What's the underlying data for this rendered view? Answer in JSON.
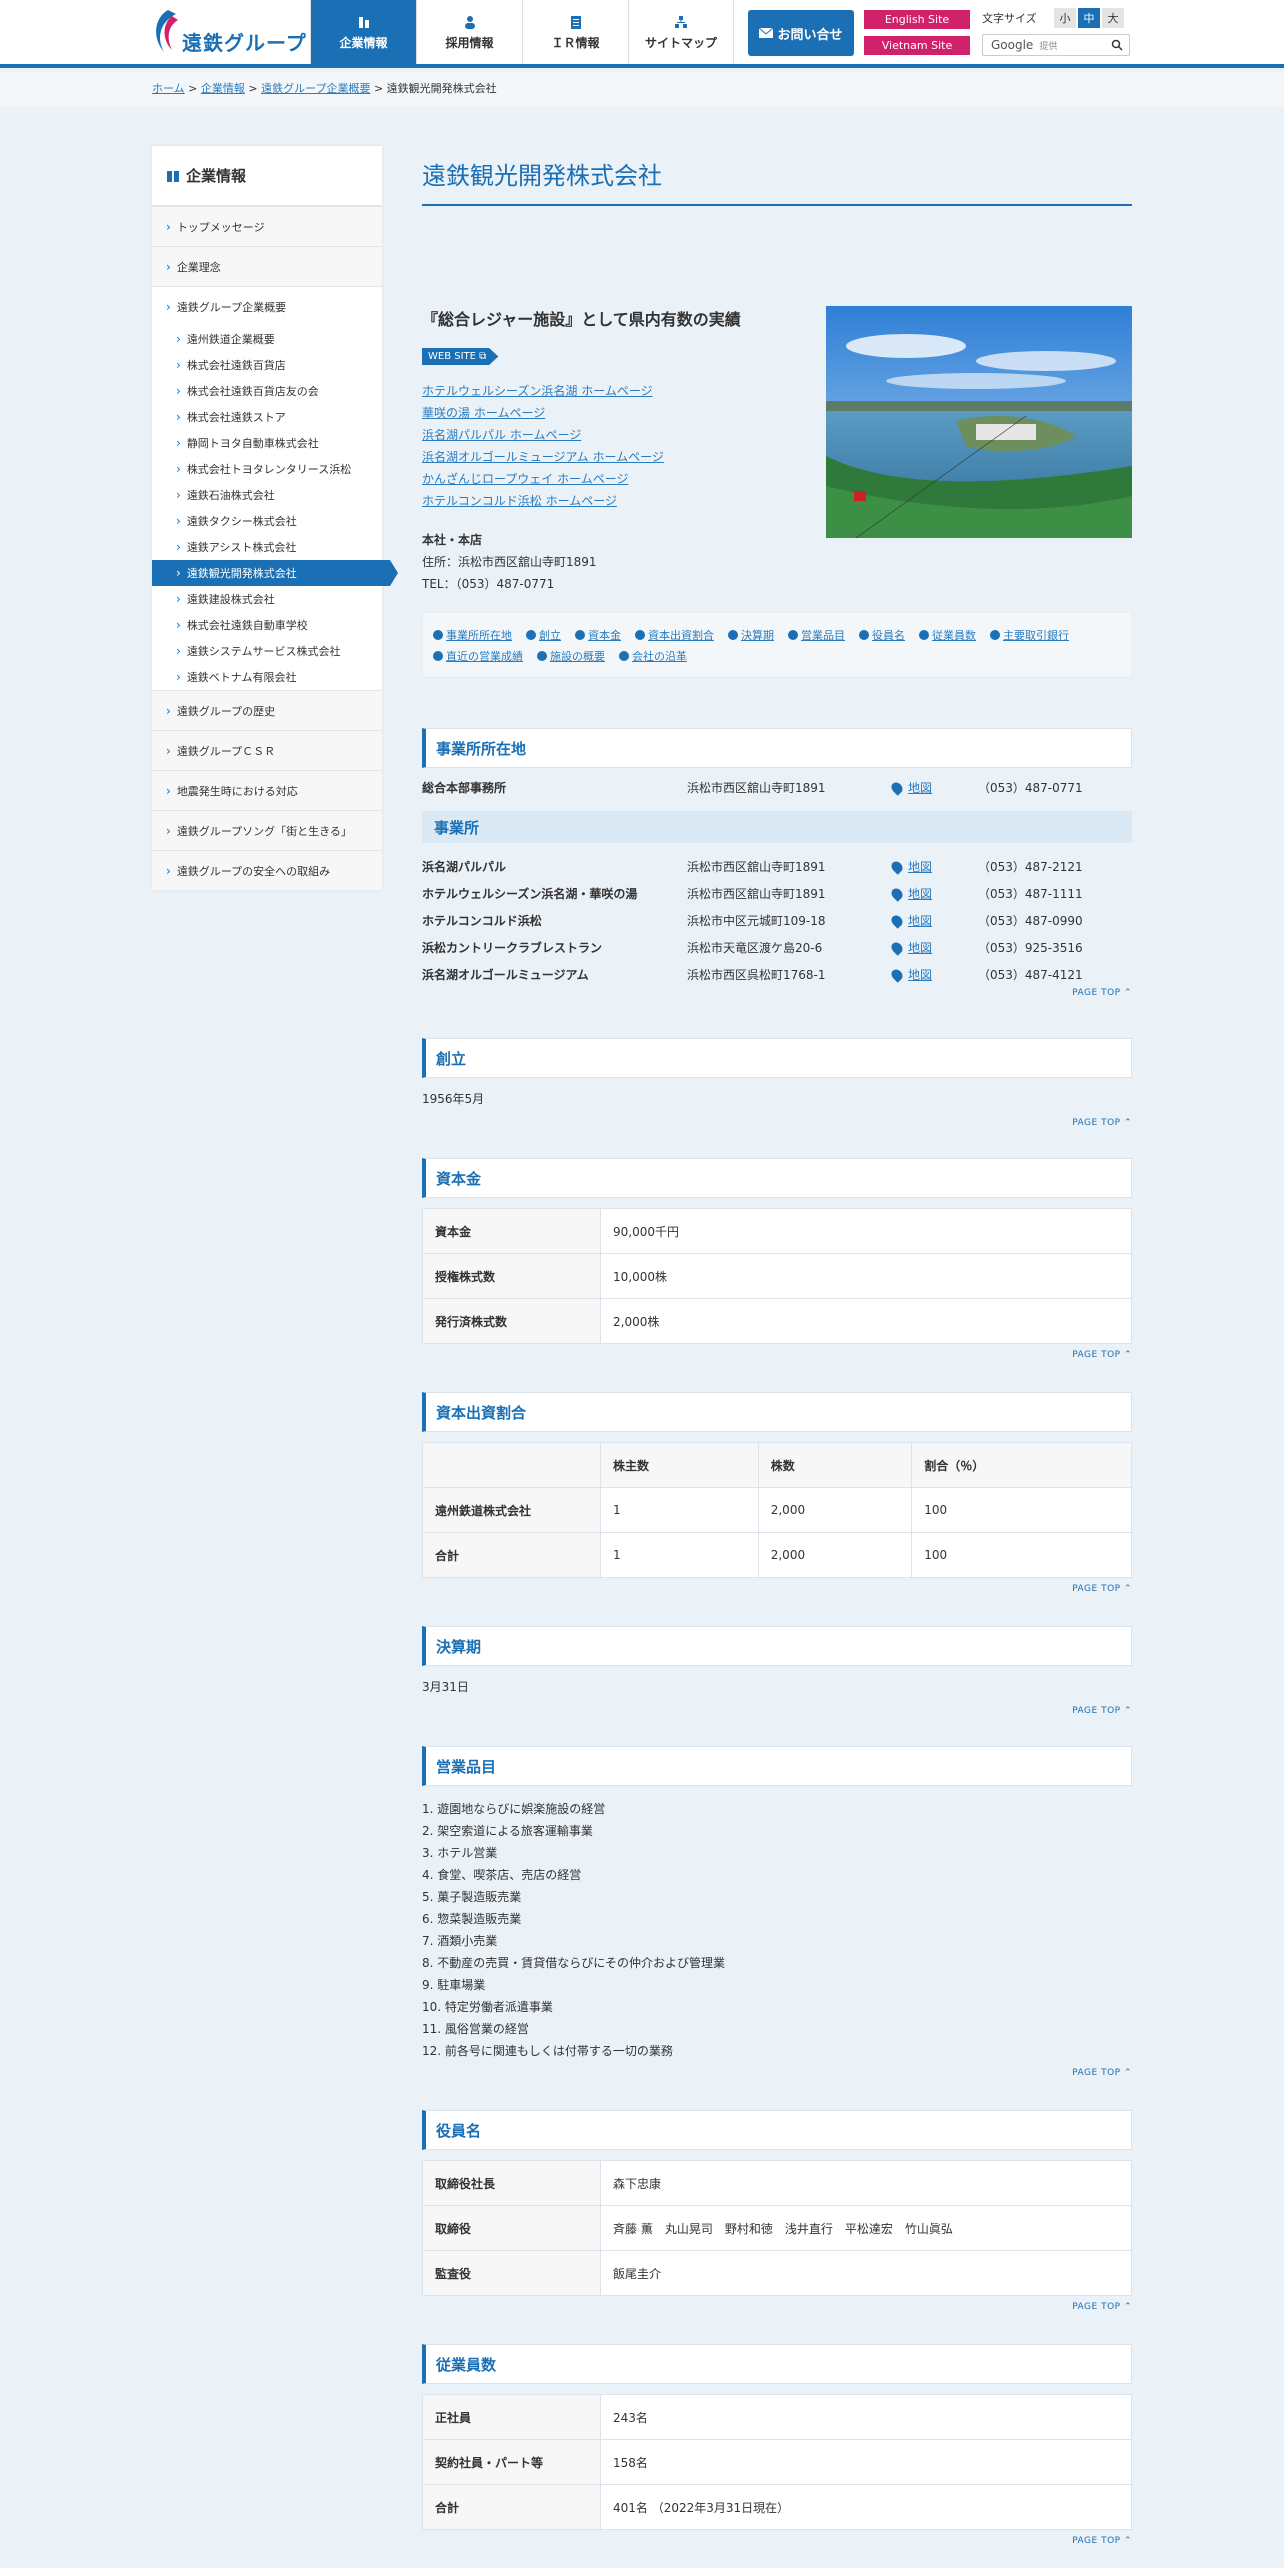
{
  "header": {
    "logo_text": "遠鉄グループ",
    "nav": [
      {
        "label": "企業情報",
        "icon": "building-icon"
      },
      {
        "label": "採用情報",
        "icon": "person-icon"
      },
      {
        "label": "ＩＲ情報",
        "icon": "document-icon"
      },
      {
        "label": "サイトマップ",
        "icon": "sitemap-icon"
      }
    ],
    "contact": "お問い合せ",
    "english": "English Site",
    "vietnam": "Vietnam Site",
    "fontsize_label": "文字サイズ",
    "fs_small": "小",
    "fs_mid": "中",
    "fs_large": "大",
    "search_google": "Google",
    "search_placeholder": "提供"
  },
  "breadcrumb": {
    "home": "ホーム",
    "corp": "企業情報",
    "group": "遠鉄グループ企業概要",
    "current": "遠鉄観光開発株式会社",
    "sep": " > "
  },
  "sidebar": {
    "title": "企業情報",
    "l1a": [
      "トップメッセージ",
      "企業理念",
      "遠鉄グループ企業概要"
    ],
    "l2": [
      "遠州鉄道企業概要",
      "株式会社遠鉄百貨店",
      "株式会社遠鉄百貨店友の会",
      "株式会社遠鉄ストア",
      "静岡トヨタ自動車株式会社",
      "株式会社トヨタレンタリース浜松",
      "遠鉄石油株式会社",
      "遠鉄タクシー株式会社",
      "遠鉄アシスト株式会社",
      "遠鉄観光開発株式会社",
      "遠鉄建設株式会社",
      "株式会社遠鉄自動車学校",
      "遠鉄システムサービス株式会社",
      "遠鉄ベトナム有限会社"
    ],
    "l1b": [
      "遠鉄グループの歴史",
      "遠鉄グループＣＳＲ",
      "地震発生時における対応",
      "遠鉄グループソング「街と生きる」",
      "遠鉄グループの安全への取組み"
    ]
  },
  "main": {
    "title": "遠鉄観光開発株式会社",
    "catch": "『総合レジャー施設』として県内有数の実績",
    "website_tag": "WEB SITE",
    "links": [
      "ホテルウェルシーズン浜名湖 ホームページ",
      "華咲の湯 ホームページ",
      "浜名湖パルパル ホームページ",
      "浜名湖オルゴールミュージアム ホームページ",
      "かんざんじロープウェイ ホームページ",
      "ホテルコンコルド浜松 ホームページ"
    ],
    "office_heading": "本社・本店",
    "office_address": "住所：浜松市西区舘山寺町1891",
    "office_tel": "TEL：（053）487-0771"
  },
  "toc": [
    "事業所所在地",
    "創立",
    "資本金",
    "資本出資割合",
    "決算期",
    "営業品目",
    "役員名",
    "従業員数",
    "主要取引銀行",
    "直近の営業成績",
    "施設の概要",
    "会社の沿革"
  ],
  "pagetop": "PAGE TOP",
  "locations": {
    "heading": "事業所所在地",
    "hq": {
      "name": "総合本部事務所",
      "address": "浜松市西区舘山寺町1891",
      "map": "地図",
      "tel": "（053）487-0771"
    },
    "sub_heading": "事業所",
    "items": [
      {
        "name": "浜名湖パルパル",
        "address": "浜松市西区舘山寺町1891",
        "map": "地図",
        "tel": "（053）487-2121"
      },
      {
        "name": "ホテルウェルシーズン浜名湖・華咲の湯",
        "address": "浜松市西区舘山寺町1891",
        "map": "地図",
        "tel": "（053）487-1111"
      },
      {
        "name": "ホテルコンコルド浜松",
        "address": "浜松市中区元城町109-18",
        "map": "地図",
        "tel": "（053）487-0990"
      },
      {
        "name": "浜松カントリークラブレストラン",
        "address": "浜松市天竜区渡ケ島20-6",
        "map": "地図",
        "tel": "（053）925-3516"
      },
      {
        "name": "浜名湖オルゴールミュージアム",
        "address": "浜松市西区呉松町1768-1",
        "map": "地図",
        "tel": "（053）487-4121"
      }
    ]
  },
  "founded": {
    "heading": "創立",
    "value": "1956年5月"
  },
  "capital": {
    "heading": "資本金",
    "rows": [
      [
        "資本金",
        "90,000千円"
      ],
      [
        "授権株式数",
        "10,000株"
      ],
      [
        "発行済株式数",
        "2,000株"
      ]
    ]
  },
  "shares": {
    "heading": "資本出資割合",
    "head": [
      "",
      "株主数",
      "株数",
      "割合（％）"
    ],
    "rows": [
      [
        "遠州鉄道株式会社",
        "1",
        "2,000",
        "100"
      ],
      [
        "合計",
        "1",
        "2,000",
        "100"
      ]
    ]
  },
  "fiscal": {
    "heading": "決算期",
    "value": "3月31日"
  },
  "business": {
    "heading": "営業品目",
    "items": [
      "1. 遊園地ならびに娯楽施設の経営",
      "2. 架空索道による旅客運輸事業",
      "3. ホテル営業",
      "4. 食堂、喫茶店、売店の経営",
      "5. 菓子製造販売業",
      "6. 惣菜製造販売業",
      "7. 酒類小売業",
      "8. 不動産の売買・賃貸借ならびにその仲介および管理業",
      "9. 駐車場業",
      "10. 特定労働者派遣事業",
      "11. 風俗営業の経営",
      "12. 前各号に関連もしくは付帯する一切の業務"
    ]
  },
  "officers": {
    "heading": "役員名",
    "rows": [
      [
        "取締役社長",
        "森下忠康"
      ],
      [
        "取締役",
        "斉藤 薫　丸山晃司　野村和徳　浅井直行　平松達宏　竹山眞弘"
      ],
      [
        "監査役",
        "飯尾圭介"
      ]
    ]
  },
  "employees": {
    "heading": "従業員数",
    "rows": [
      [
        "正社員",
        "243名"
      ],
      [
        "契約社員・パート等",
        "158名"
      ],
      [
        "合計",
        "401名 （2022年3月31日現在）"
      ]
    ]
  }
}
